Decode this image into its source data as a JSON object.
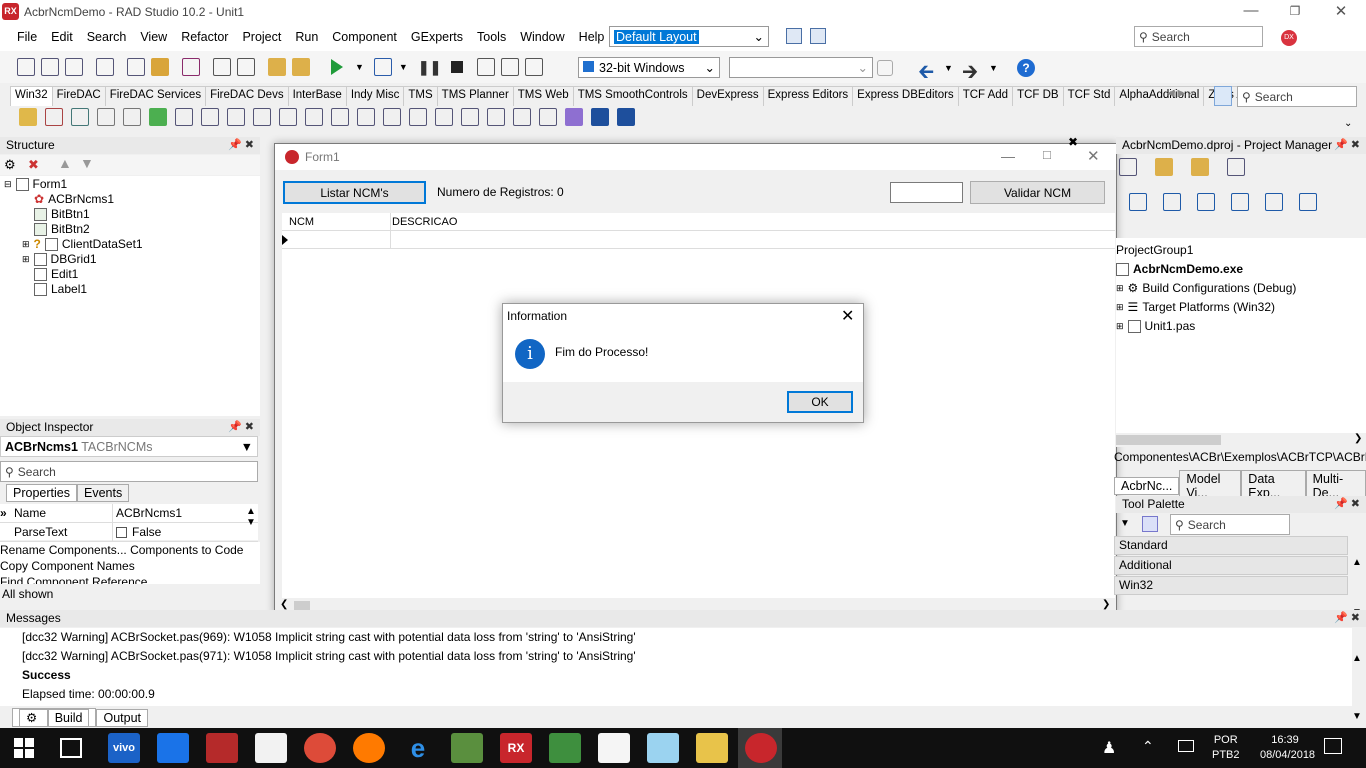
{
  "window": {
    "title": "AcbrNcmDemo - RAD Studio 10.2 - Unit1",
    "logo": "RX"
  },
  "menu": [
    "File",
    "Edit",
    "Search",
    "View",
    "Refactor",
    "Project",
    "Run",
    "Component",
    "GExperts",
    "Tools",
    "Window",
    "Help"
  ],
  "layout_combo": "Default Layout",
  "search_placeholder": "Search",
  "platform_combo": "32-bit Windows",
  "palette_tabs": [
    "Win32",
    "FireDAC",
    "FireDAC Services",
    "FireDAC Devs",
    "InterBase",
    "Indy Misc",
    "TMS",
    "TMS Planner",
    "TMS Web",
    "TMS SmoothControls",
    "DevExpress",
    "Express Editors",
    "Express DBEditors",
    "TCF Add",
    "TCF DB",
    "TCF Std",
    "AlphaAdditional",
    "Zeos Access",
    "A"
  ],
  "structure": {
    "title": "Structure",
    "items": [
      "Form1",
      "ACBrNcms1",
      "BitBtn1",
      "BitBtn2",
      "ClientDataSet1",
      "DBGrid1",
      "Edit1",
      "Label1"
    ]
  },
  "object_inspector": {
    "title": "Object Inspector",
    "selected": "ACBrNcms1",
    "type": "TACBrNCMs",
    "search": "Search",
    "tab_properties": "Properties",
    "tab_events": "Events",
    "props": [
      {
        "name": "Name",
        "value": "ACBrNcms1"
      },
      {
        "name": "ParseText",
        "value": "False"
      }
    ],
    "link1": "Rename Components...",
    "link2": "Components to Code",
    "link3": "Copy Component Names",
    "link4": "Find Component Reference",
    "status": "All shown"
  },
  "form1": {
    "title": "Form1",
    "btn_list": "Listar NCM's",
    "count_label": "Numero de Registros: 0",
    "btn_validate": "Validar NCM",
    "col1": "NCM",
    "col2": "DESCRICAO"
  },
  "dialog": {
    "title": "Information",
    "message": "Fim do Processo!",
    "ok": "OK"
  },
  "project_manager": {
    "title": "AcbrNcmDemo.dproj - Project Manager",
    "group": "ProjectGroup1",
    "exe": "AcbrNcmDemo.exe",
    "build": "Build Configurations (Debug)",
    "target": "Target Platforms (Win32)",
    "unit": "Unit1.pas",
    "path": "Componentes\\ACBr\\Exemplos\\ACBrTCP\\ACBrN",
    "tab1": "AcbrNc...",
    "tab2": "Model Vi...",
    "tab3": "Data Exp...",
    "tab4": "Multi-De..."
  },
  "tool_palette": {
    "title": "Tool Palette",
    "search": "Search",
    "items": [
      "Standard",
      "Additional",
      "Win32"
    ]
  },
  "messages": {
    "title": "Messages",
    "lines": [
      "[dcc32 Warning] ACBrSocket.pas(969): W1058 Implicit string cast with potential data loss from 'string' to 'AnsiString'",
      "[dcc32 Warning] ACBrSocket.pas(971): W1058 Implicit string cast with potential data loss from 'string' to 'AnsiString'"
    ],
    "success": "Success",
    "elapsed": "Elapsed time: 00:00:00.9",
    "tab_build": "Build",
    "tab_output": "Output"
  },
  "taskbar": {
    "lang1": "POR",
    "lang2": "PTB2",
    "time": "16:39",
    "date": "08/04/2018",
    "vivo": "vivo",
    "rx": "RX"
  }
}
